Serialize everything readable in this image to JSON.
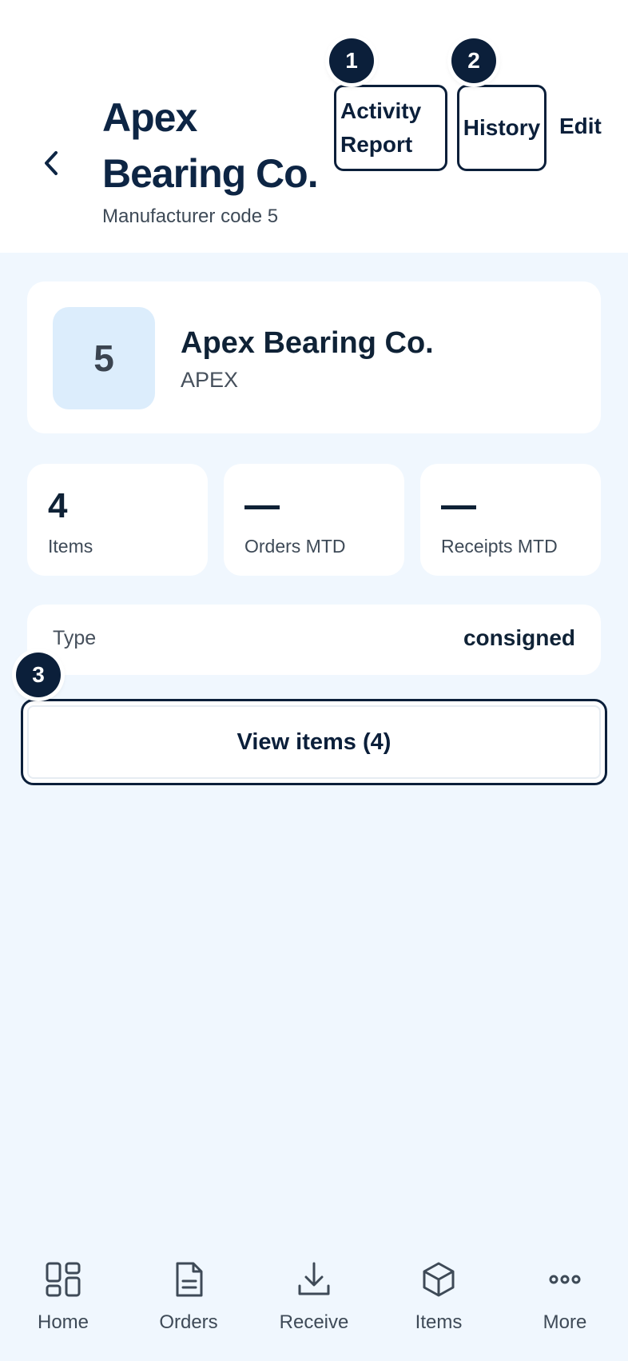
{
  "header": {
    "title": "Apex Bearing Co.",
    "subtitle": "Manufacturer code 5",
    "actions": {
      "activity_report": "Activity Report",
      "history": "History",
      "edit": "Edit"
    }
  },
  "badges": [
    "1",
    "2",
    "3"
  ],
  "manufacturer": {
    "avatar": "5",
    "name": "Apex Bearing Co.",
    "code": "APEX"
  },
  "stats": [
    {
      "value": "4",
      "label": "Items"
    },
    {
      "value": "—",
      "label": "Orders MTD"
    },
    {
      "value": "—",
      "label": "Receipts MTD"
    }
  ],
  "details": {
    "type_label": "Type",
    "type_value": "consigned"
  },
  "view_items_label": "View items (4)",
  "nav": {
    "items": [
      {
        "label": "Home",
        "icon": "home-grid-icon"
      },
      {
        "label": "Orders",
        "icon": "document-icon"
      },
      {
        "label": "Receive",
        "icon": "download-icon"
      },
      {
        "label": "Items",
        "icon": "cube-icon"
      },
      {
        "label": "More",
        "icon": "more-dots-icon"
      }
    ]
  },
  "colors": {
    "background": "#f0f7fe",
    "primary": "#0b1f3a",
    "avatar_bg": "#dcedfc",
    "card": "#ffffff"
  }
}
